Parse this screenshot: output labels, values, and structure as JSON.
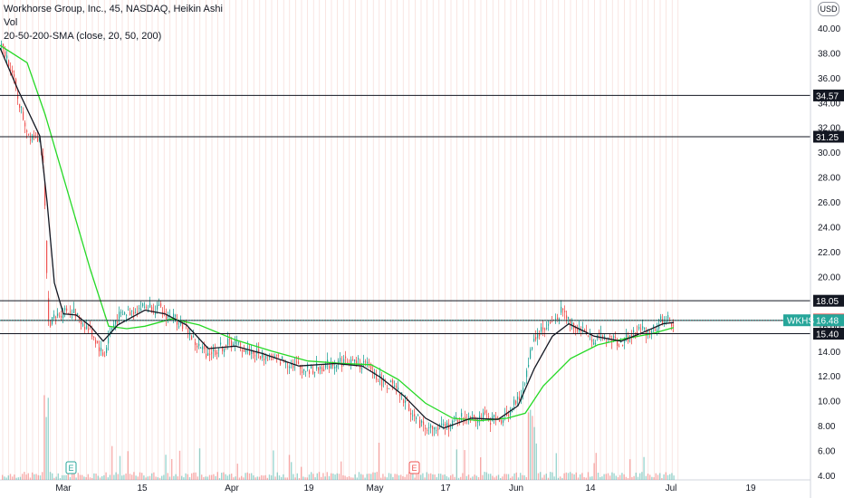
{
  "header": {
    "title": "Workhorse Group, Inc., 45, NASDAQ, Heikin Ashi",
    "volume_label": "Vol",
    "sma_label": "20-50-200-SMA (close, 20, 50, 200)",
    "currency": "USD"
  },
  "chart_data": {
    "type": "candlestick",
    "symbol": "WKHS",
    "ylim": [
      4,
      41
    ],
    "y_ticks": [
      "40.00",
      "38.00",
      "36.00",
      "34.00",
      "32.00",
      "30.00",
      "28.00",
      "26.00",
      "24.00",
      "22.00",
      "20.00",
      "18.00",
      "16.00",
      "14.00",
      "12.00",
      "10.00",
      "8.00",
      "6.00",
      "4.00"
    ],
    "x_ticks": [
      "Mar",
      "15",
      "Apr",
      "19",
      "May",
      "17",
      "Jun",
      "14",
      "Jul",
      "19"
    ],
    "price_path": [
      [
        0,
        38.5
      ],
      [
        10,
        37.2
      ],
      [
        18,
        34.8
      ],
      [
        26,
        32.5
      ],
      [
        32,
        31.3
      ],
      [
        38,
        31.6
      ],
      [
        44,
        31.0
      ],
      [
        48,
        28
      ],
      [
        51,
        20
      ],
      [
        53,
        16.4
      ],
      [
        58,
        16.5
      ],
      [
        64,
        16.9
      ],
      [
        72,
        17.4
      ],
      [
        80,
        17.1
      ],
      [
        90,
        16.3
      ],
      [
        100,
        15.6
      ],
      [
        108,
        14.5
      ],
      [
        114,
        13.5
      ],
      [
        120,
        15.3
      ],
      [
        128,
        16.6
      ],
      [
        140,
        17.1
      ],
      [
        150,
        17.4
      ],
      [
        160,
        17.6
      ],
      [
        172,
        17.5
      ],
      [
        182,
        16.9
      ],
      [
        194,
        16.6
      ],
      [
        206,
        15.8
      ],
      [
        216,
        14.5
      ],
      [
        226,
        13.9
      ],
      [
        236,
        14.0
      ],
      [
        246,
        14.4
      ],
      [
        256,
        14.8
      ],
      [
        266,
        14.3
      ],
      [
        278,
        13.9
      ],
      [
        290,
        13.6
      ],
      [
        302,
        13.4
      ],
      [
        312,
        13.2
      ],
      [
        322,
        13.0
      ],
      [
        334,
        12.6
      ],
      [
        344,
        12.5
      ],
      [
        354,
        12.7
      ],
      [
        366,
        13.0
      ],
      [
        378,
        13.2
      ],
      [
        390,
        13.1
      ],
      [
        402,
        12.9
      ],
      [
        412,
        12.3
      ],
      [
        422,
        11.5
      ],
      [
        432,
        11.2
      ],
      [
        442,
        10.4
      ],
      [
        450,
        9.6
      ],
      [
        458,
        8.6
      ],
      [
        466,
        8.1
      ],
      [
        474,
        7.8
      ],
      [
        482,
        7.6
      ],
      [
        490,
        7.9
      ],
      [
        500,
        8.3
      ],
      [
        510,
        8.7
      ],
      [
        520,
        8.8
      ],
      [
        530,
        8.7
      ],
      [
        540,
        8.5
      ],
      [
        550,
        8.4
      ],
      [
        558,
        8.8
      ],
      [
        566,
        9.6
      ],
      [
        574,
        10.2
      ],
      [
        582,
        12.6
      ],
      [
        588,
        15.0
      ],
      [
        596,
        15.6
      ],
      [
        604,
        16.0
      ],
      [
        612,
        16.5
      ],
      [
        620,
        17.3
      ],
      [
        628,
        16.4
      ],
      [
        636,
        16.0
      ],
      [
        646,
        15.5
      ],
      [
        656,
        15.0
      ],
      [
        666,
        15.1
      ],
      [
        676,
        14.9
      ],
      [
        686,
        14.7
      ],
      [
        696,
        15.2
      ],
      [
        706,
        15.7
      ],
      [
        716,
        15.6
      ],
      [
        724,
        16.0
      ],
      [
        732,
        16.6
      ],
      [
        740,
        16.4
      ],
      [
        744,
        16.1
      ]
    ],
    "sma_20": [
      [
        0,
        38.4
      ],
      [
        20,
        35.0
      ],
      [
        44,
        31.3
      ],
      [
        52,
        26
      ],
      [
        60,
        19.5
      ],
      [
        70,
        17.0
      ],
      [
        84,
        16.9
      ],
      [
        100,
        16.0
      ],
      [
        114,
        14.8
      ],
      [
        130,
        16.1
      ],
      [
        160,
        17.3
      ],
      [
        182,
        17.0
      ],
      [
        206,
        16.1
      ],
      [
        230,
        14.2
      ],
      [
        260,
        14.4
      ],
      [
        290,
        13.8
      ],
      [
        330,
        12.8
      ],
      [
        370,
        13.0
      ],
      [
        400,
        12.8
      ],
      [
        420,
        11.9
      ],
      [
        446,
        10.4
      ],
      [
        470,
        8.6
      ],
      [
        490,
        7.8
      ],
      [
        520,
        8.6
      ],
      [
        550,
        8.5
      ],
      [
        572,
        9.6
      ],
      [
        590,
        12.6
      ],
      [
        610,
        15.2
      ],
      [
        628,
        16.2
      ],
      [
        656,
        15.2
      ],
      [
        686,
        14.8
      ],
      [
        710,
        15.5
      ],
      [
        732,
        16.2
      ],
      [
        744,
        16.3
      ]
    ],
    "sma_50": [
      [
        0,
        38.6
      ],
      [
        30,
        37.2
      ],
      [
        50,
        33.0
      ],
      [
        70,
        28.0
      ],
      [
        100,
        20.5
      ],
      [
        120,
        16.0
      ],
      [
        140,
        15.8
      ],
      [
        160,
        16.0
      ],
      [
        190,
        16.6
      ],
      [
        220,
        16.1
      ],
      [
        260,
        14.9
      ],
      [
        300,
        14.0
      ],
      [
        340,
        13.2
      ],
      [
        380,
        13.0
      ],
      [
        410,
        12.9
      ],
      [
        440,
        11.7
      ],
      [
        470,
        9.8
      ],
      [
        500,
        8.6
      ],
      [
        530,
        8.4
      ],
      [
        560,
        8.6
      ],
      [
        580,
        9.0
      ],
      [
        600,
        11.2
      ],
      [
        630,
        13.4
      ],
      [
        660,
        14.5
      ],
      [
        690,
        15.0
      ],
      [
        720,
        15.4
      ],
      [
        744,
        15.9
      ]
    ],
    "h_levels": [
      {
        "value": 34.57,
        "label": "34.57"
      },
      {
        "value": 31.25,
        "label": "31.25"
      },
      {
        "value": 18.05,
        "label": "18.05"
      },
      {
        "value": 16.47,
        "label": "16.47"
      },
      {
        "value": 15.4,
        "label": "15.40"
      }
    ],
    "last_price": {
      "value": 16.48,
      "label": "16.48",
      "symbol": "WKHS",
      "color": "#26a69a"
    },
    "sma_marker": {
      "value": 16.54,
      "label": "16.54",
      "color": "#ef5350"
    },
    "earnings_markers": [
      "E",
      "E"
    ],
    "colors": {
      "up": "#26a69a",
      "down": "#ef5350",
      "sma20": "#131722",
      "sma50": "#26d926",
      "grid": "#f5d6d0"
    }
  }
}
